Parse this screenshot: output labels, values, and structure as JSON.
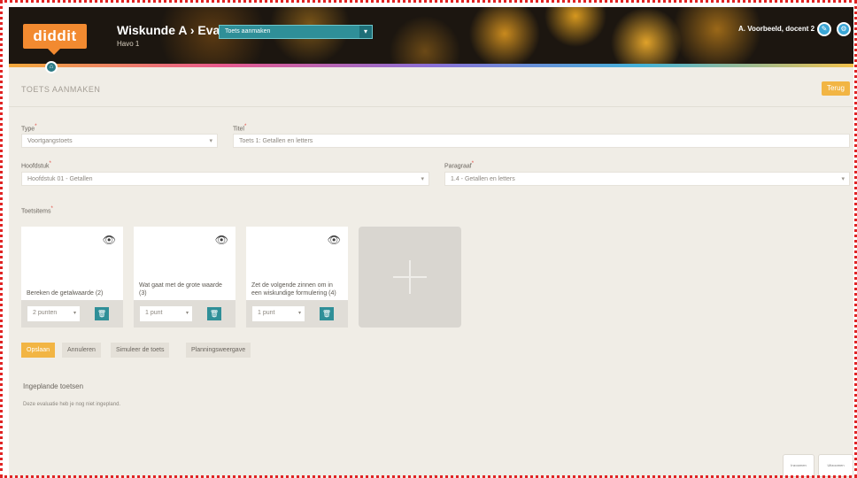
{
  "header": {
    "logo": "diddit",
    "title": "Wiskunde A › Evalueren ›",
    "subtitle": "Havo 1",
    "select_label": "Toets aanmaken",
    "user": "A. Voorbeeld, docent 2"
  },
  "page": {
    "title": "TOETS AANMAKEN",
    "back_button": "Terug"
  },
  "form": {
    "type_label": "Type",
    "type_value": "Voortgangstoets",
    "titel_label": "Titel",
    "titel_value": "Toets 1: Getallen en letters",
    "hoofdstuk_label": "Hoofdstuk",
    "hoofdstuk_value": "Hoofdstuk 01 - Getallen",
    "paragraaf_label": "Paragraaf",
    "paragraaf_value": "1.4 - Getallen en letters",
    "toetsitems_label": "Toetsitems"
  },
  "cards": [
    {
      "text": "Bereken de getalwaarde (2)",
      "points": "2 punten"
    },
    {
      "text": "Wat gaat met de grote waarde (3)",
      "points": "1 punt"
    },
    {
      "text": "Zet de volgende zinnen om in een wiskundige formulering (4)",
      "points": "1 punt"
    }
  ],
  "tabs": [
    "Opslaan",
    "Annuleren",
    "Simuleer de toets",
    "Planningsweergave"
  ],
  "section": {
    "title": "Ingeplande toetsen",
    "text": "Deze evaluatie heb je nog niet ingepland."
  },
  "corner_buttons": [
    "Inzoomen",
    "Uitzoomen"
  ],
  "colors": {
    "accent": "#f2b544",
    "teal": "#2f8f98",
    "logo": "#f28a30"
  }
}
